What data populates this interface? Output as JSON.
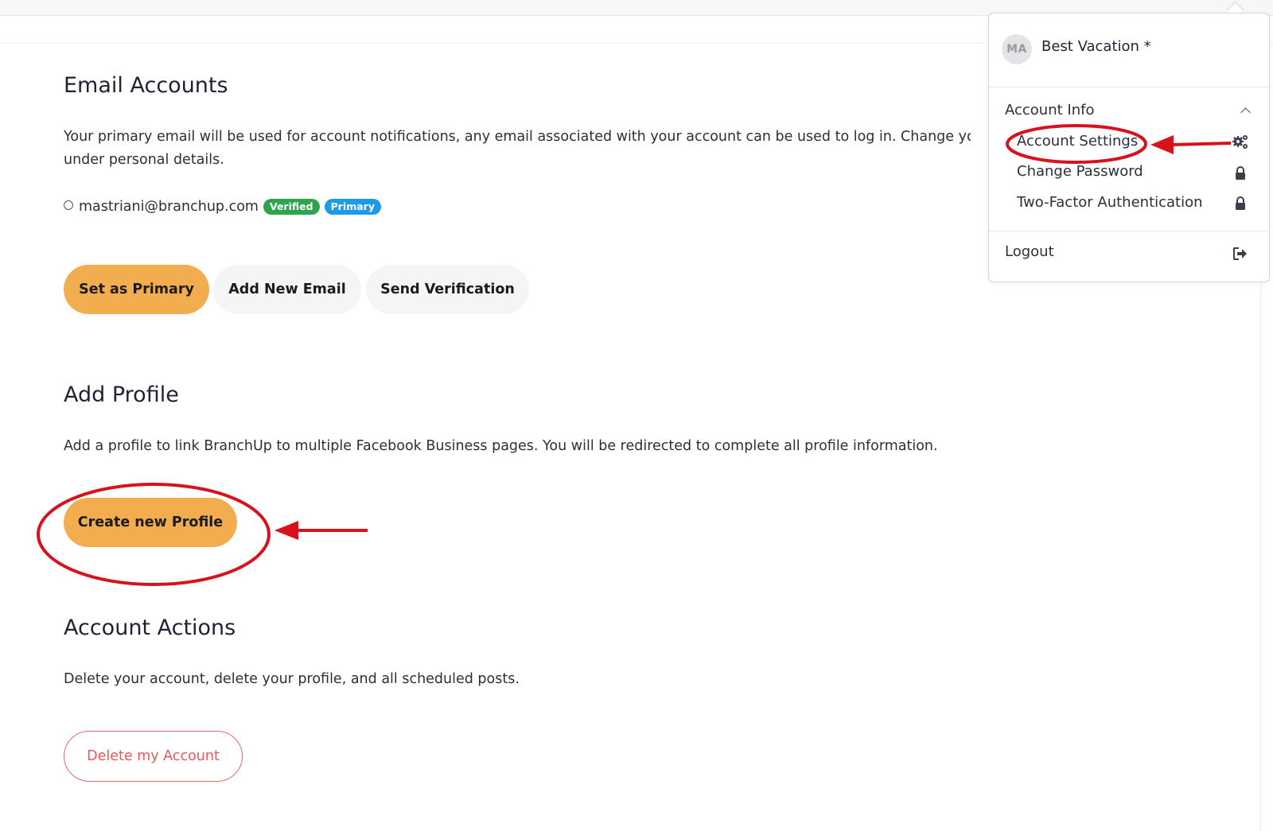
{
  "email_accounts": {
    "title": "Email Accounts",
    "description_line1": "Your primary email will be used for account notifications, any email associated with your account can be used to log in. Change your pub",
    "description_line2": "under personal details.",
    "email": "mastriani@branchup.com",
    "badge_verified": "Verified",
    "badge_primary": "Primary",
    "set_primary_label": "Set as Primary",
    "add_email_label": "Add New Email",
    "send_verification_label": "Send Verification"
  },
  "add_profile": {
    "title": "Add Profile",
    "description": "Add a profile to link BranchUp to multiple Facebook Business pages. You will be redirected to complete all profile information.",
    "create_label": "Create new Profile"
  },
  "account_actions": {
    "title": "Account Actions",
    "description": "Delete your account, delete your profile, and all scheduled posts.",
    "delete_label": "Delete my Account"
  },
  "dropdown": {
    "avatar_initials": "MA",
    "account_name": "Best Vacation *",
    "section_label": "Account Info",
    "items": [
      {
        "label": "Account Settings",
        "icon": "gears-icon"
      },
      {
        "label": "Change Password",
        "icon": "lock-icon"
      },
      {
        "label": "Two-Factor Authentication",
        "icon": "lock-icon"
      }
    ],
    "logout_label": "Logout",
    "logout_icon": "logout-icon"
  },
  "colors": {
    "accent_orange": "#f2ad4e",
    "annotation_red": "#d8121c",
    "verified_green": "#2ea44f",
    "primary_blue": "#1e9be6",
    "danger_red": "#e35a5a"
  }
}
